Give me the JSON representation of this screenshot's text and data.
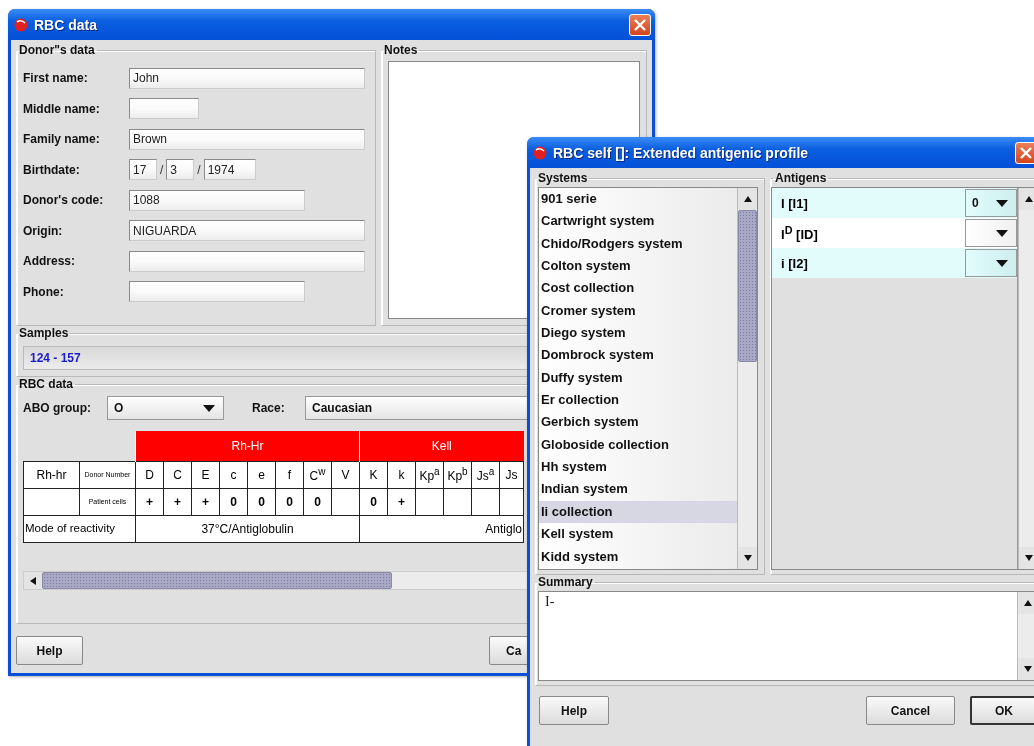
{
  "main_window": {
    "title": "RBC data",
    "donor_panel": {
      "title": "Donor\"s data",
      "fields": [
        {
          "label": "First name:",
          "kind": "wide",
          "value": "John"
        },
        {
          "label": "Middle name:",
          "kind": "narrow"
        },
        {
          "label": "Family name:",
          "kind": "wide",
          "value": "Brown"
        },
        {
          "label": "Birthdate:",
          "kind": "date",
          "parts": [
            "17",
            "3",
            "1974"
          ],
          "separator": "/"
        },
        {
          "label": "Donor's code:",
          "kind": "medium",
          "value": "1088"
        },
        {
          "label": "Origin:",
          "kind": "wide",
          "value": "NIGUARDA"
        },
        {
          "label": "Address:",
          "kind": "wide"
        },
        {
          "label": "Phone:",
          "kind": "medium"
        }
      ]
    },
    "notes_panel": {
      "title": "Notes"
    },
    "samples_panel": {
      "title": "Samples",
      "value": "124 - 157"
    },
    "rbc_panel": {
      "title": "RBC data",
      "abo": {
        "label": "ABO group:",
        "value": "O"
      },
      "race": {
        "label": "Race:",
        "value": "Caucasian"
      },
      "table": {
        "row_labels": [
          "Rh-hr",
          "Donor Number",
          "Patient cells",
          "Mode of reactivity"
        ],
        "groups": [
          {
            "label": "Rh-Hr",
            "mode": "37°C/Antiglobulin",
            "columns": [
              {
                "header": "D",
                "patient": "+"
              },
              {
                "header": "C",
                "patient": "+"
              },
              {
                "header": "E",
                "patient": "+"
              },
              {
                "header": "c",
                "patient": "0"
              },
              {
                "header": "e",
                "patient": "0"
              },
              {
                "header": "f",
                "patient": "0"
              },
              {
                "header": "C$^{w}$",
                "patient": "0"
              },
              {
                "header": "V"
              }
            ]
          },
          {
            "label": "Kell",
            "mode": "Antiglo",
            "columns": [
              {
                "header": "K",
                "patient": "0"
              },
              {
                "header": "k",
                "patient": "+"
              },
              {
                "header": "Kp$^{a}$"
              },
              {
                "header": "Kp$^{b}$"
              },
              {
                "header": "Js$^{a}$"
              },
              {
                "header": "Js"
              }
            ]
          }
        ]
      }
    },
    "buttons": [
      "Help",
      "Ca"
    ]
  },
  "profile_window": {
    "title": "RBC self []: Extended antigenic profile",
    "systems_panel": {
      "title": "Systems",
      "items": [
        {
          "label": "901 serie",
          "selected": false
        },
        {
          "label": "Cartwright system",
          "selected": false
        },
        {
          "label": "Chido/Rodgers system",
          "selected": false
        },
        {
          "label": "Colton system",
          "selected": false
        },
        {
          "label": "Cost collection",
          "selected": false
        },
        {
          "label": "Cromer system",
          "selected": false
        },
        {
          "label": "Diego system",
          "selected": false
        },
        {
          "label": "Dombrock system",
          "selected": false
        },
        {
          "label": "Duffy system",
          "selected": false
        },
        {
          "label": "Er collection",
          "selected": false
        },
        {
          "label": "Gerbich system",
          "selected": false
        },
        {
          "label": "Globoside collection",
          "selected": false
        },
        {
          "label": "Hh system",
          "selected": false
        },
        {
          "label": "Indian system",
          "selected": false
        },
        {
          "label": "Ii collection",
          "selected": true
        },
        {
          "label": "Kell system",
          "selected": false
        },
        {
          "label": "Kidd system",
          "selected": false
        }
      ]
    },
    "antigens_panel": {
      "title": "Antigens",
      "rows": [
        {
          "name": "I [I1]",
          "value": "0"
        },
        {
          "name": "I$^{D}$ [ID]"
        },
        {
          "name": "i [I2]"
        }
      ]
    },
    "summary_panel": {
      "title": "Summary",
      "text": "I-"
    },
    "buttons": [
      "Help",
      "Cancel",
      "OK"
    ]
  }
}
